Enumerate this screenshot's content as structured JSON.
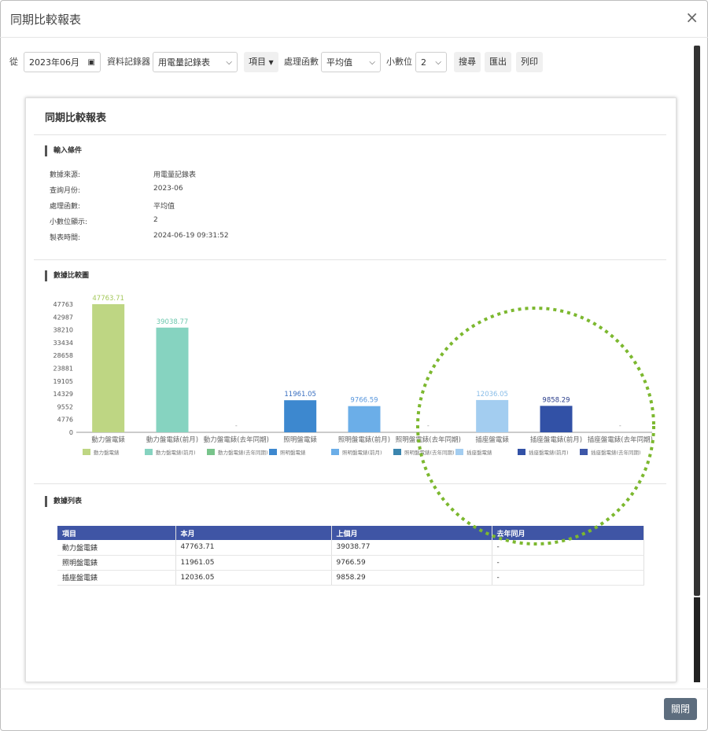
{
  "window": {
    "title": "同期比較報表",
    "close_symbol": "×"
  },
  "toolbar": {
    "from_label": "從",
    "date_value": "2023年06月",
    "recorder_label": "資料記錄器",
    "recorder_value": "用電量記錄表",
    "item_button": "項目",
    "function_label": "處理函數",
    "function_value": "平均值",
    "decimal_label": "小數位",
    "decimal_value": "2",
    "search_button": "搜尋",
    "export_button": "匯出",
    "print_button": "列印"
  },
  "report": {
    "title": "同期比較報表",
    "input_section": "輸入條件",
    "info": [
      {
        "label": "數據來源:",
        "value": "用電量記錄表"
      },
      {
        "label": "查詢月份:",
        "value": "2023-06"
      },
      {
        "label": "處理函數:",
        "value": "平均值"
      },
      {
        "label": "小數位顯示:",
        "value": "2"
      },
      {
        "label": "製表時間:",
        "value": "2024-06-19 09:31:52"
      }
    ],
    "chart_section": "數據比較圖",
    "table_section": "數據列表"
  },
  "chart_data": {
    "type": "bar",
    "categories": [
      "動力盤電錶",
      "動力盤電錶(前月)",
      "動力盤電錶(去年同期)",
      "照明盤電錶",
      "照明盤電錶(前月)",
      "照明盤電錶(去年同期)",
      "插座盤電錶",
      "插座盤電錶(前月)",
      "插座盤電錶(去年同期)"
    ],
    "values": [
      47763.71,
      39038.77,
      0,
      11961.05,
      9766.59,
      0,
      12036.05,
      9858.29,
      0
    ],
    "value_labels": [
      "47763.71",
      "39038.77",
      "-",
      "11961.05",
      "9766.59",
      "-",
      "12036.05",
      "9858.29",
      "-"
    ],
    "colors": [
      "#bed683",
      "#86d3c0",
      "#78c48b",
      "#3d88cf",
      "#6baee8",
      "#3b85ae",
      "#a3cdf0",
      "#3251a6",
      "#3e57a8"
    ],
    "label_colors": [
      "#a4c85a",
      "#6cc7ad",
      "#999999",
      "#3a6fc0",
      "#5a98dd",
      "#999999",
      "#88bde8",
      "#2c3f8c",
      "#999999"
    ],
    "yticks": [
      "0",
      "4776",
      "9552",
      "14329",
      "19105",
      "23881",
      "28658",
      "33434",
      "38210",
      "42987",
      "47763"
    ],
    "ylim": [
      0,
      47763
    ],
    "legend": [
      "動力盤電錶",
      "動力盤電錶(前月)",
      "動力盤電錶(去年同期)",
      "照明盤電錶",
      "照明盤電錶(前月)",
      "照明盤電錶(去年同期)",
      "插座盤電錶",
      "插座盤電錶(前月)",
      "插座盤電錶(去年同期)"
    ],
    "legend_placement": "bottom",
    "grid": false
  },
  "table": {
    "headers": [
      "項目",
      "本月",
      "上個月",
      "去年同月"
    ],
    "rows": [
      [
        "動力盤電錶",
        "47763.71",
        "39038.77",
        "-"
      ],
      [
        "照明盤電錶",
        "11961.05",
        "9766.59",
        "-"
      ],
      [
        "插座盤電錶",
        "12036.05",
        "9858.29",
        "-"
      ]
    ]
  },
  "annotation": {
    "color": "#7cb82f"
  },
  "footer": {
    "close_button": "關閉"
  }
}
